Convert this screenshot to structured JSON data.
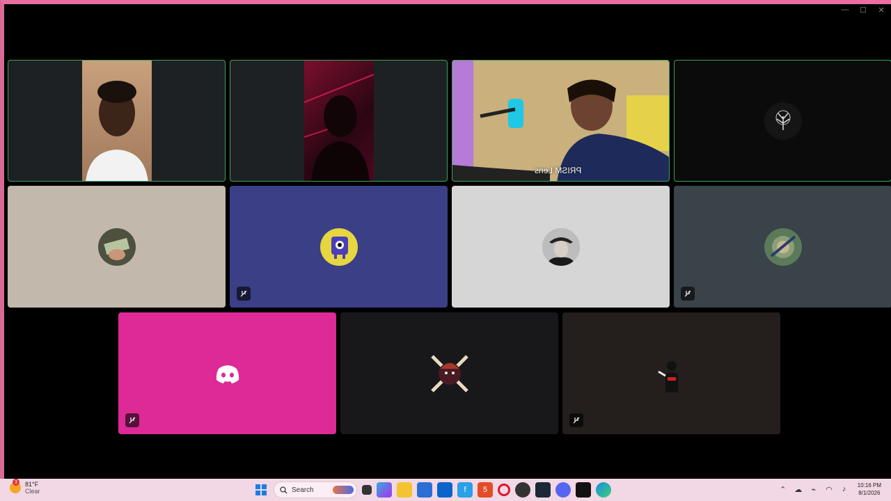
{
  "window": {
    "controls": [
      "—",
      "☐",
      "✕"
    ]
  },
  "participants": [
    {
      "id": "p1",
      "type": "video",
      "speaking": true,
      "bg": "#1e2124",
      "stripColor": "#b88a6a"
    },
    {
      "id": "p2",
      "type": "video",
      "speaking": true,
      "bg": "#1e2124",
      "stripColor": "#5a1530"
    },
    {
      "id": "p3",
      "type": "video",
      "speaking": true,
      "bg": "#3a3040",
      "name": "PRISM Lens"
    },
    {
      "id": "p4",
      "type": "avatar",
      "speaking": true,
      "bg": "#0b0b0c",
      "avatarColor": "#222"
    },
    {
      "id": "p5",
      "type": "avatar",
      "speaking": false,
      "bg": "#c2b8ab",
      "avatarColor": "#5b5a4c",
      "muted": false
    },
    {
      "id": "p6",
      "type": "avatar",
      "speaking": false,
      "bg": "#3a3f86",
      "avatarColor": "#e6d640",
      "muted": true
    },
    {
      "id": "p7",
      "type": "avatar",
      "speaking": false,
      "bg": "#d6d6d6",
      "avatarColor": "#444",
      "muted": false
    },
    {
      "id": "p8",
      "type": "avatar",
      "speaking": false,
      "bg": "#394349",
      "avatarColor": "#5b7a5a",
      "muted": true
    },
    {
      "id": "p9",
      "type": "discord",
      "speaking": false,
      "bg": "#dd2a96",
      "muted": true
    },
    {
      "id": "p10",
      "type": "avatar",
      "speaking": false,
      "bg": "#18181b",
      "avatarColor": "#4a1a22",
      "muted": false
    },
    {
      "id": "p11",
      "type": "avatar",
      "speaking": false,
      "bg": "#241e1c",
      "avatarColor": "#2a2222",
      "muted": true
    }
  ],
  "taskbar": {
    "weather": {
      "temp": "81°F",
      "condition": "Clear",
      "badge": "3"
    },
    "search_placeholder": "Search",
    "apps": [
      "files",
      "explorer",
      "store",
      "outlook",
      "facebook",
      "html5",
      "opera",
      "chrome",
      "steam",
      "discord",
      "audio",
      "edge"
    ],
    "time": "10:16 PM",
    "date": "8/1/2026"
  },
  "colors": {
    "speaking_border": "#3ba55c",
    "taskbar_bg": "#f1d8e4",
    "desktop_accent": "#e86fa0"
  }
}
